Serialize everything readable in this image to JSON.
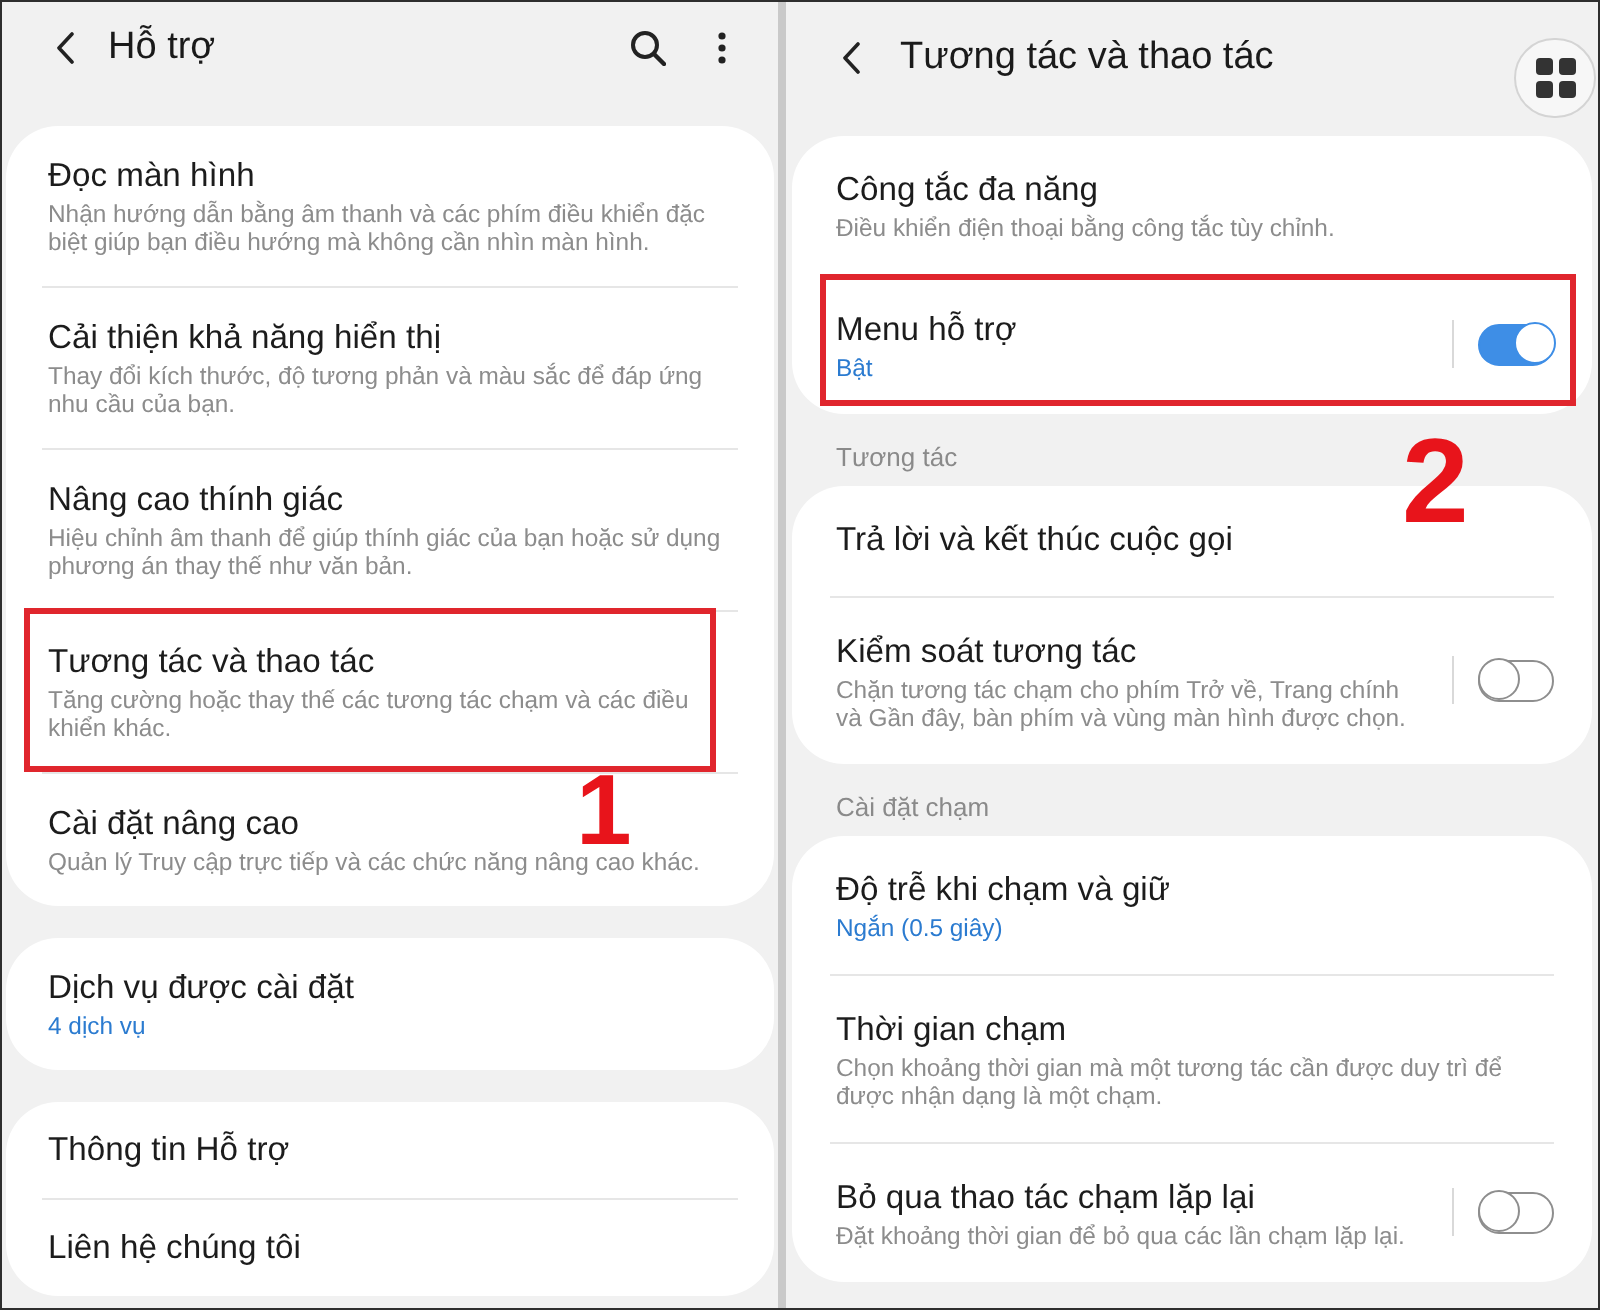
{
  "left_screen": {
    "title": "Hỗ trợ",
    "groups": [
      {
        "items": [
          {
            "title": "Đọc màn hình",
            "subtitle": "Nhận hướng dẫn bằng âm thanh và các phím điều khiển đặc biệt giúp bạn điều hướng mà không cần nhìn màn hình.",
            "highlighted": false
          },
          {
            "title": "Cải thiện khả năng hiển thị",
            "subtitle": "Thay đổi kích thước, độ tương phản và màu sắc để đáp ứng nhu cầu của bạn.",
            "highlighted": false
          },
          {
            "title": "Nâng cao thính giác",
            "subtitle": "Hiệu chỉnh âm thanh để giúp thính giác của bạn hoặc sử dụng phương án thay thế như văn bản.",
            "highlighted": false
          },
          {
            "title": "Tương tác và thao tác",
            "subtitle": "Tăng cường hoặc thay thế các tương tác chạm và các điều khiển khác.",
            "highlighted": true,
            "marker": "1"
          },
          {
            "title": "Cài đặt nâng cao",
            "subtitle": "Quản lý Truy cập trực tiếp và các chức năng nâng cao khác.",
            "highlighted": false
          }
        ]
      },
      {
        "items": [
          {
            "title": "Dịch vụ được cài đặt",
            "value": "4 dịch vụ",
            "highlighted": false
          }
        ]
      },
      {
        "items": [
          {
            "title": "Thông tin Hỗ trợ",
            "highlighted": false
          },
          {
            "title": "Liên hệ chúng tôi",
            "highlighted": false
          }
        ]
      }
    ]
  },
  "right_screen": {
    "title": "Tương tác và thao tác",
    "sections": [
      {
        "items": [
          {
            "kind": "plain",
            "title": "Công tắc đa năng",
            "subtitle": "Điều khiển điện thoại bằng công tắc tùy chỉnh.",
            "highlighted": false
          },
          {
            "kind": "switch",
            "title": "Menu hỗ trợ",
            "value": "Bật",
            "on": true,
            "highlighted": true,
            "marker": "2"
          }
        ]
      },
      {
        "header": "Tương tác",
        "items": [
          {
            "kind": "plain",
            "title": "Trả lời và kết thúc cuộc gọi",
            "highlighted": false
          },
          {
            "kind": "switch",
            "title": "Kiểm soát tương tác",
            "subtitle": "Chặn tương tác chạm cho phím Trở về, Trang chính và Gần đây, bàn phím và vùng màn hình được chọn.",
            "on": false,
            "highlighted": false
          }
        ]
      },
      {
        "header": "Cài đặt chạm",
        "items": [
          {
            "kind": "plain",
            "title": "Độ trễ khi chạm và giữ",
            "value": "Ngắn (0.5 giây)",
            "highlighted": false
          },
          {
            "kind": "plain",
            "title": "Thời gian chạm",
            "subtitle": "Chọn khoảng thời gian mà một tương tác cần được duy trì để được nhận dạng là một chạm.",
            "highlighted": false
          },
          {
            "kind": "switch",
            "title": "Bỏ qua thao tác chạm lặp lại",
            "subtitle": "Đặt khoảng thời gian để bỏ qua các lần chạm lặp lại.",
            "on": false,
            "highlighted": false
          }
        ]
      }
    ]
  }
}
